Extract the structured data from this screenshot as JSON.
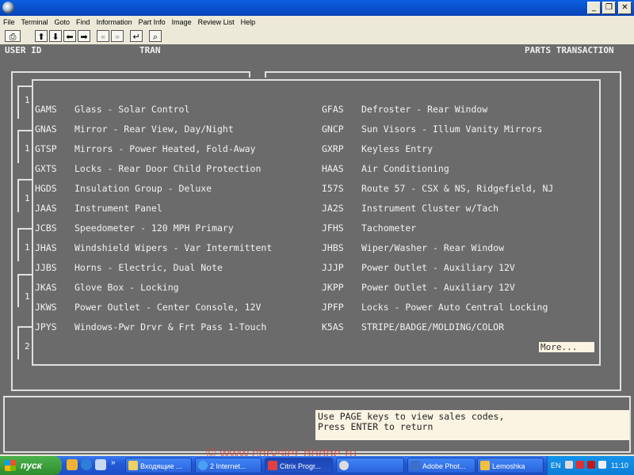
{
  "window": {
    "minimize": "_",
    "restore": "❐",
    "close": "✕"
  },
  "menu": [
    "File",
    "Terminal",
    "Goto",
    "Find",
    "Information",
    "Part Info",
    "Image",
    "Review List",
    "Help"
  ],
  "toolbar": {
    "print": "⎙",
    "up": "⬆",
    "down": "⬇",
    "left": "⬅",
    "right": "➡",
    "rewind": "«",
    "forward": "»",
    "enter": "↵",
    "search": "⌕"
  },
  "header": {
    "user_id": "USER ID",
    "tran": "TRAN",
    "title": "PARTS TRANSACTION"
  },
  "side_numbers": [
    "1",
    "1",
    "1",
    "1",
    "1",
    "2"
  ],
  "parts": [
    {
      "code1": "GAMS",
      "desc1": "Glass - Solar Control",
      "code2": "GFAS",
      "desc2": "Defroster - Rear Window"
    },
    {
      "code1": "GNAS",
      "desc1": "Mirror - Rear View, Day/Night",
      "code2": "GNCP",
      "desc2": "Sun Visors - Illum Vanity Mirrors"
    },
    {
      "code1": "GTSP",
      "desc1": "Mirrors - Power Heated, Fold-Away",
      "code2": "GXRP",
      "desc2": "Keyless Entry"
    },
    {
      "code1": "GXTS",
      "desc1": "Locks - Rear Door Child Protection",
      "code2": "HAAS",
      "desc2": "Air Conditioning"
    },
    {
      "code1": "HGDS",
      "desc1": "Insulation Group - Deluxe",
      "code2": "I57S",
      "desc2": "Route 57 - CSX & NS, Ridgefield, NJ"
    },
    {
      "code1": "JAAS",
      "desc1": "Instrument Panel",
      "code2": "JA2S",
      "desc2": "Instrument Cluster w/Tach"
    },
    {
      "code1": "JCBS",
      "desc1": "Speedometer - 120 MPH Primary",
      "code2": "JFHS",
      "desc2": "Tachometer"
    },
    {
      "code1": "JHAS",
      "desc1": "Windshield Wipers - Var Intermittent",
      "code2": "JHBS",
      "desc2": "Wiper/Washer - Rear Window"
    },
    {
      "code1": "JJBS",
      "desc1": "Horns - Electric, Dual Note",
      "code2": "JJJP",
      "desc2": "Power Outlet - Auxiliary 12V"
    },
    {
      "code1": "JKAS",
      "desc1": "Glove Box - Locking",
      "code2": "JKPP",
      "desc2": "Power Outlet - Auxiliary 12V"
    },
    {
      "code1": "JKWS",
      "desc1": "Power Outlet - Center Console, 12V",
      "code2": "JPFP",
      "desc2": "Locks - Power Auto Central Locking"
    },
    {
      "code1": "JPYS",
      "desc1": "Windows-Pwr Drvr & Frt Pass 1-Touch",
      "code2": "K5AS",
      "desc2": "STRIPE/BADGE/MOLDING/COLOR"
    }
  ],
  "more_label": "More...",
  "message_lines": [
    "Use PAGE keys to view sales codes,",
    "Press ENTER to return"
  ],
  "watermark": "© www.chrysler-dodge.ru",
  "taskbar": {
    "start": "пуск",
    "tasks": [
      "Входящие ...",
      "2 Internet...",
      "Citrix Progr...",
      "",
      "Adobe Phot...",
      "Lemoshka"
    ],
    "lang": "EN",
    "clock": "11:10"
  },
  "colors": {
    "terminal_bg": "#6b6b6b",
    "terminal_text": "#f2f2f2",
    "taskbar": "#2359d6",
    "titlebar": "#0a5fe0"
  }
}
